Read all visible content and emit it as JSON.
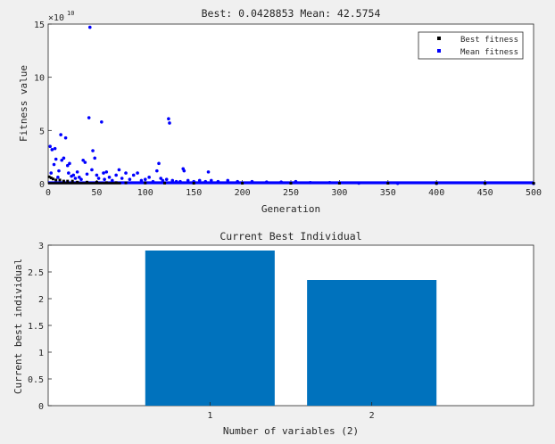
{
  "chart_data": [
    {
      "type": "scatter",
      "title": "Best: 0.0428853 Mean: 42.5754",
      "xlabel": "Generation",
      "ylabel": "Fitness value",
      "xlim": [
        0,
        500
      ],
      "ylim": [
        0,
        15
      ],
      "y_exponent_label": "×10",
      "y_exponent_power": "10",
      "xticks": [
        "0",
        "50",
        "100",
        "150",
        "200",
        "250",
        "300",
        "350",
        "400",
        "450",
        "500"
      ],
      "yticks": [
        "0",
        "5",
        "10",
        "15"
      ],
      "grid": false,
      "legend_position": "top-right",
      "legend": [
        {
          "label": "Best fitness",
          "color": "#000000",
          "marker": "square"
        },
        {
          "label": "Mean fitness",
          "color": "#0000ff",
          "marker": "dot"
        }
      ],
      "series": [
        {
          "name": "Best fitness",
          "color": "#000000",
          "x": [
            1,
            3,
            5,
            8,
            12,
            16,
            20,
            25,
            30,
            40,
            50,
            60,
            70,
            80,
            100,
            120,
            150,
            200,
            250,
            300,
            350,
            400,
            450,
            500
          ],
          "y": [
            0.6,
            0.5,
            0.4,
            0.3,
            0.3,
            0.2,
            0.2,
            0.2,
            0.1,
            0.1,
            0.1,
            0.05,
            0.05,
            0.03,
            0.02,
            0.01,
            0,
            0,
            0,
            0,
            0,
            0,
            0,
            0
          ]
        },
        {
          "name": "Mean fitness",
          "color": "#0000ff",
          "x": [
            2,
            3,
            4,
            6,
            7,
            8,
            10,
            11,
            13,
            14,
            16,
            18,
            20,
            21,
            22,
            24,
            26,
            28,
            30,
            32,
            34,
            36,
            38,
            40,
            42,
            43,
            45,
            46,
            48,
            50,
            52,
            55,
            57,
            58,
            60,
            63,
            66,
            70,
            73,
            76,
            80,
            84,
            88,
            92,
            96,
            100,
            104,
            108,
            112,
            114,
            116,
            118,
            122,
            124,
            125,
            128,
            132,
            136,
            139,
            140,
            144,
            150,
            156,
            162,
            165,
            168,
            175,
            185,
            195,
            210,
            225,
            240,
            255,
            270,
            290,
            320,
            360,
            400,
            450,
            500
          ],
          "y": [
            3.5,
            1.0,
            3.2,
            1.8,
            3.3,
            2.3,
            0.6,
            1.2,
            4.6,
            2.2,
            2.4,
            4.3,
            1.7,
            1.0,
            1.9,
            0.7,
            0.8,
            0.5,
            1.1,
            0.6,
            0.4,
            2.2,
            2.0,
            0.9,
            6.2,
            14.7,
            1.3,
            3.1,
            2.4,
            0.8,
            0.5,
            5.8,
            1.0,
            0.4,
            1.1,
            0.6,
            0.3,
            0.8,
            1.3,
            0.5,
            1.0,
            0.4,
            0.8,
            1.0,
            0.3,
            0.4,
            0.6,
            0.2,
            1.2,
            1.9,
            0.5,
            0.3,
            0.4,
            6.1,
            5.7,
            0.3,
            0.2,
            0.2,
            1.4,
            1.2,
            0.3,
            0.2,
            0.3,
            0.2,
            1.1,
            0.3,
            0.2,
            0.3,
            0.2,
            0.2,
            0.15,
            0.15,
            0.2,
            0.1,
            0.1,
            0.05,
            0.03,
            0.02,
            0.02,
            0.01
          ]
        }
      ]
    },
    {
      "type": "bar",
      "title": "Current Best Individual",
      "xlabel": "Number of variables (2)",
      "ylabel": "Current best individual",
      "categories": [
        "1",
        "2"
      ],
      "values": [
        2.9,
        2.35
      ],
      "xlim": [
        0,
        3
      ],
      "ylim": [
        0,
        3
      ],
      "yticks": [
        "0",
        "0.5",
        "1",
        "1.5",
        "2",
        "2.5",
        "3"
      ],
      "color": "#0072bd",
      "grid": false
    }
  ]
}
